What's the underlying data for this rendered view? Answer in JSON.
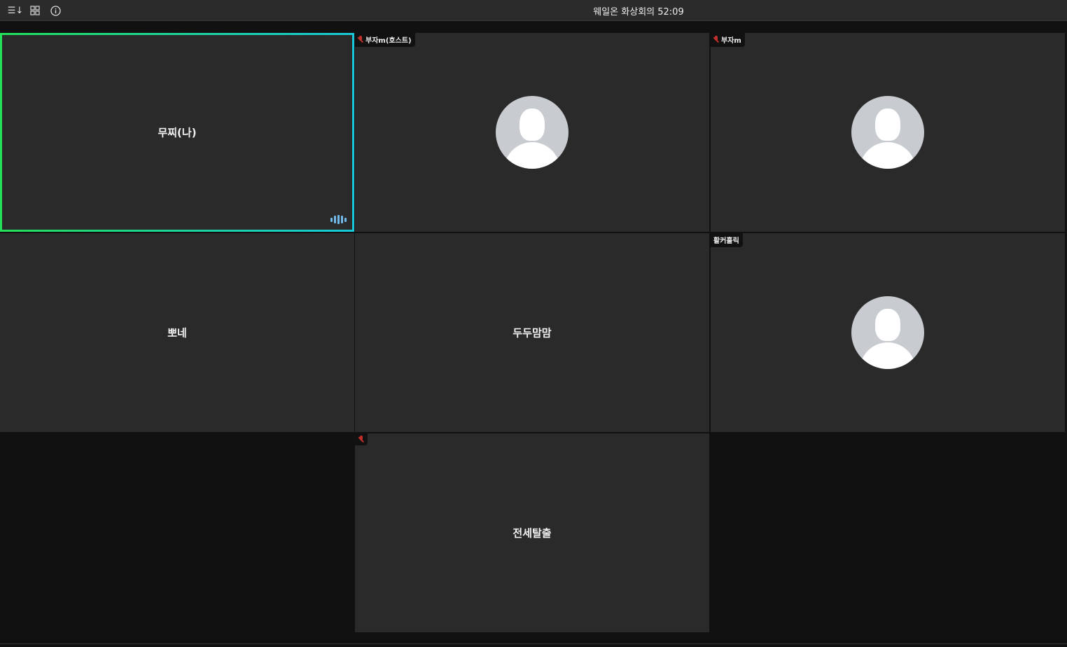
{
  "topbar": {
    "title": "웨일온 화상회의 52:09",
    "icons": [
      "sort-icon",
      "grid-layout-icon",
      "info-icon"
    ]
  },
  "tiles": [
    {
      "name": "무찌(나)",
      "self": true,
      "speaking": true
    },
    {
      "tag": "부자m(호스트)",
      "muted": true,
      "avatar": true
    },
    {
      "tag": "부자m",
      "muted": true,
      "avatar": true
    },
    {
      "name": "뽀네"
    },
    {
      "name": "두두맘맘"
    },
    {
      "tag": "활커홀릭",
      "avatar": true
    },
    {
      "name": "전세탈출",
      "muted": true
    }
  ],
  "colors": {
    "self_border_start": "#22e05a",
    "self_border_end": "#18c8d8",
    "muted": "#c0302a",
    "speaking": "#6fb8e8"
  }
}
